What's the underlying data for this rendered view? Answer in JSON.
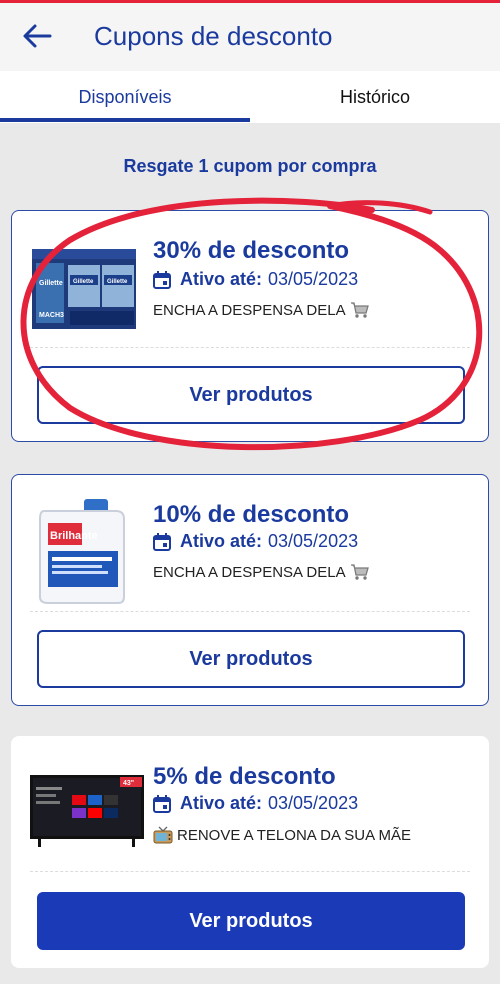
{
  "header": {
    "title": "Cupons de desconto"
  },
  "tabs": [
    {
      "label": "Disponíveis",
      "active": true
    },
    {
      "label": "Histórico",
      "active": false
    }
  ],
  "notice": "Resgate 1 cupom por compra",
  "coupons": [
    {
      "discount": "30% de desconto",
      "valid_label": "Ativo até:",
      "valid_date": "03/05/2023",
      "description": "ENCHA A DESPENSA DELA",
      "desc_icon": "cart-icon",
      "button": "Ver produtos",
      "button_style": "outline",
      "product": "razor-pack",
      "product_texts": [
        "Gillette",
        "MACH3",
        "Gillette",
        "Gillette"
      ]
    },
    {
      "discount": "10% de desconto",
      "valid_label": "Ativo até:",
      "valid_date": "03/05/2023",
      "description": "ENCHA A DESPENSA DELA",
      "desc_icon": "cart-icon",
      "button": "Ver produtos",
      "button_style": "outline",
      "product": "detergent-jug",
      "product_texts": [
        "Brilhante"
      ]
    },
    {
      "discount": "5% de desconto",
      "valid_label": "Ativo até:",
      "valid_date": "03/05/2023",
      "description": "RENOVE A TELONA DA SUA MÃE",
      "desc_icon": "tv-icon",
      "button": "Ver produtos",
      "button_style": "filled",
      "product": "smart-tv",
      "product_texts": [
        "43\""
      ]
    }
  ],
  "colors": {
    "primary": "#1b3a9e",
    "button_filled": "#1b3ab8",
    "annotation": "#e4233b",
    "background": "#e9e9e9"
  }
}
